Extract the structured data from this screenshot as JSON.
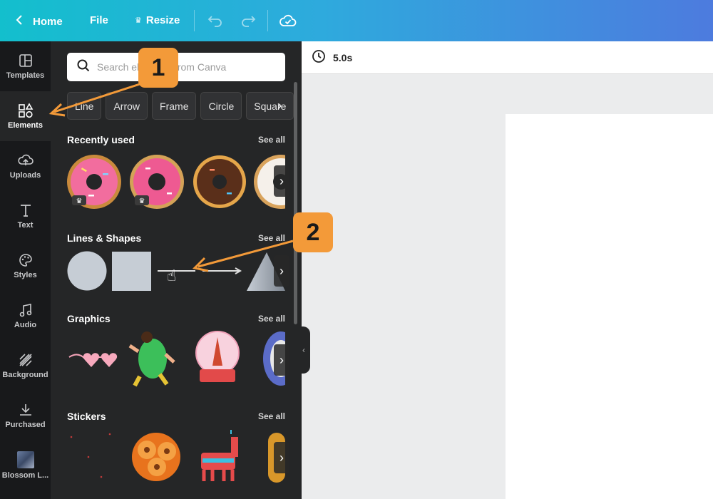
{
  "topbar": {
    "home_label": "Home",
    "file_label": "File",
    "resize_label": "Resize"
  },
  "rail": [
    {
      "label": "Templates"
    },
    {
      "label": "Elements"
    },
    {
      "label": "Uploads"
    },
    {
      "label": "Text"
    },
    {
      "label": "Styles"
    },
    {
      "label": "Audio"
    },
    {
      "label": "Background"
    },
    {
      "label": "Purchased"
    },
    {
      "label": "Blossom L..."
    }
  ],
  "panel": {
    "search_placeholder": "Search elements from Canva",
    "chips": [
      "Line",
      "Arrow",
      "Frame",
      "Circle",
      "Square"
    ],
    "sections": [
      {
        "title": "Recently used",
        "see_all": "See all"
      },
      {
        "title": "Lines & Shapes",
        "see_all": "See all"
      },
      {
        "title": "Graphics",
        "see_all": "See all"
      },
      {
        "title": "Stickers",
        "see_all": "See all"
      }
    ]
  },
  "canvas": {
    "duration": "5.0s"
  },
  "annotations": {
    "badge_1": "1",
    "badge_2": "2"
  },
  "colors": {
    "accent": "#f39a39",
    "topbar_start": "#13bfcd",
    "topbar_end": "#4d7bde",
    "panel_bg": "#252627",
    "rail_bg": "#18191b"
  }
}
